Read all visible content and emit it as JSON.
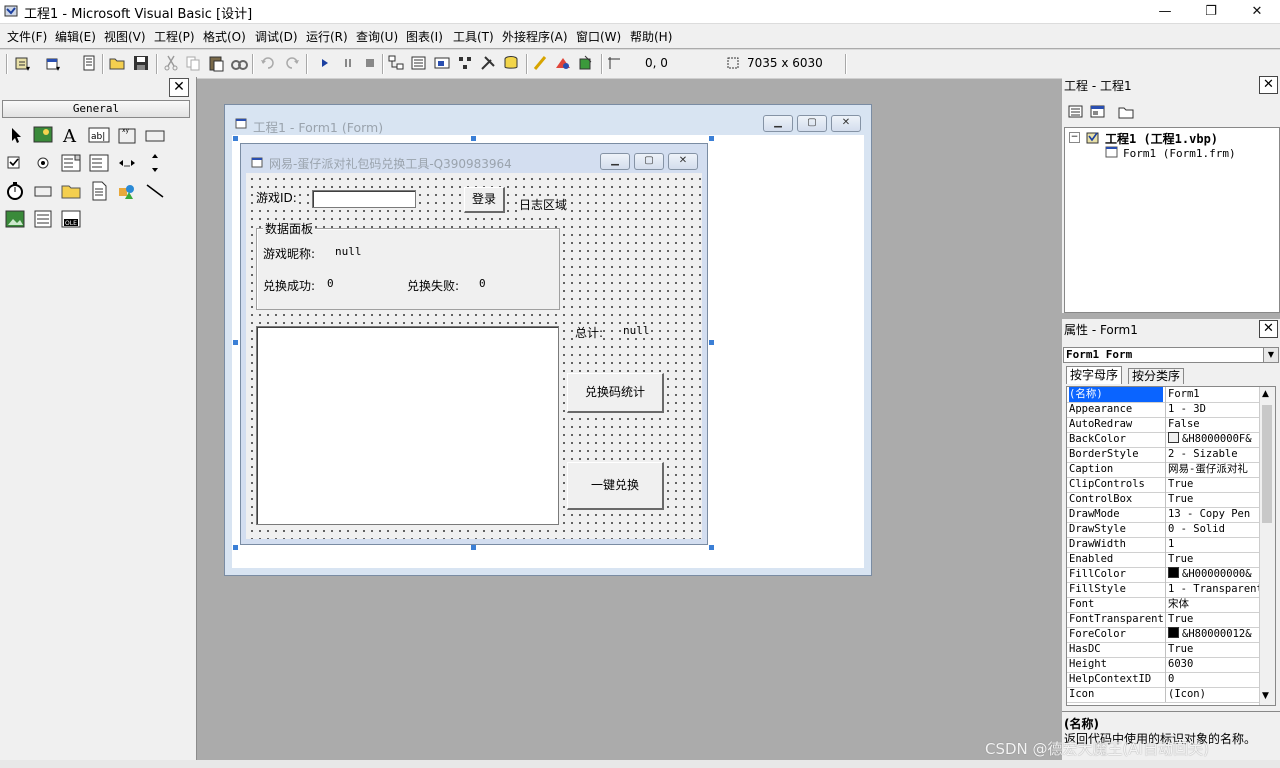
{
  "window": {
    "title": "工程1 - Microsoft Visual Basic [设计]",
    "minimize": "—",
    "restore": "❐",
    "close": "✕"
  },
  "menu": [
    "文件(F)",
    "编辑(E)",
    "视图(V)",
    "工程(P)",
    "格式(O)",
    "调试(D)",
    "运行(R)",
    "查询(U)",
    "图表(I)",
    "工具(T)",
    "外接程序(A)",
    "窗口(W)",
    "帮助(H)"
  ],
  "toolbar": {
    "position": "0, 0",
    "size": "7035 x 6030"
  },
  "toolbox": {
    "close": "✕",
    "tab_label": "General"
  },
  "form_window": {
    "title": "工程1 - Form1 (Form)"
  },
  "designed_form": {
    "caption": "网易-蛋仔派对礼包码兑换工具-Q390983964",
    "game_id_label": "游戏ID:",
    "login_button": "登录",
    "log_label": "日志区域",
    "data_panel_title": "数据面板",
    "nickname_label": "游戏昵称:",
    "nickname_value": "null",
    "success_label": "兑换成功:",
    "success_value": "0",
    "fail_label": "兑换失败:",
    "fail_value": "0",
    "total_label": "总计:",
    "total_value": "null",
    "stats_button": "兑换码统计",
    "redeem_button": "一键兑换"
  },
  "project_panel": {
    "title": "工程 - 工程1",
    "close": "✕",
    "tree_root": "工程1 (工程1.vbp)",
    "tree_child": "Form1 (Form1.frm)"
  },
  "properties_panel": {
    "title": "属性 - Form1",
    "close": "✕",
    "object_selector": "Form1 Form",
    "tab_alpha": "按字母序",
    "tab_category": "按分类序",
    "rows": [
      {
        "name": "(名称)",
        "value": "Form1"
      },
      {
        "name": "Appearance",
        "value": "1 - 3D"
      },
      {
        "name": "AutoRedraw",
        "value": "False"
      },
      {
        "name": "BackColor",
        "value": "&H8000000F&"
      },
      {
        "name": "BorderStyle",
        "value": "2 - Sizable"
      },
      {
        "name": "Caption",
        "value": "网易-蛋仔派对礼"
      },
      {
        "name": "ClipControls",
        "value": "True"
      },
      {
        "name": "ControlBox",
        "value": "True"
      },
      {
        "name": "DrawMode",
        "value": "13 - Copy Pen"
      },
      {
        "name": "DrawStyle",
        "value": "0 - Solid"
      },
      {
        "name": "DrawWidth",
        "value": "1"
      },
      {
        "name": "Enabled",
        "value": "True"
      },
      {
        "name": "FillColor",
        "value": "&H00000000&"
      },
      {
        "name": "FillStyle",
        "value": "1 - Transparent"
      },
      {
        "name": "Font",
        "value": "宋体"
      },
      {
        "name": "FontTransparent",
        "value": "True"
      },
      {
        "name": "ForeColor",
        "value": "&H80000012&"
      },
      {
        "name": "HasDC",
        "value": "True"
      },
      {
        "name": "Height",
        "value": "6030"
      },
      {
        "name": "HelpContextID",
        "value": "0"
      },
      {
        "name": "Icon",
        "value": "(Icon)"
      }
    ],
    "desc_title": "(名称)",
    "desc_text": "返回代码中使用的标识对象的名称。"
  },
  "watermark": "CSDN @德宏大魔王(AI自动回关)",
  "colors": {
    "selection": "#0a64ff",
    "title_bar_form": "#d8e4f2",
    "handle": "#3b7fd6"
  }
}
